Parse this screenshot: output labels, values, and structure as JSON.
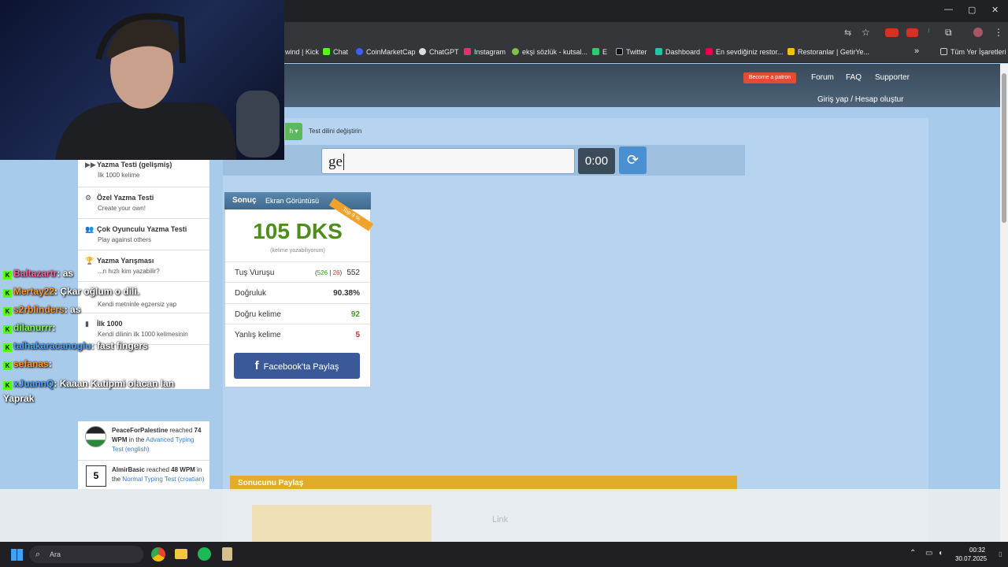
{
  "browser": {
    "bookmarks": [
      "wind | Kick",
      "Chat",
      "CoinMarketCap",
      "ChatGPT",
      "Instagram",
      "ekşi sözlük - kutsal...",
      "E",
      "Twitter",
      "Dashboard",
      "En sevdiğiniz restor...",
      "Restoranlar | GetirYe...",
      "Tüm Yer İşaretleri"
    ],
    "win_controls": [
      "—",
      "▢",
      "✕"
    ]
  },
  "site": {
    "patron": "Become a patron",
    "nav": [
      "Forum",
      "FAQ",
      "Supporter"
    ],
    "login": "Giriş yap / Hesap oluştur",
    "lang_label": "Test dilini değiştirin",
    "lang_btn": "h ▾"
  },
  "typing": {
    "input_value": "ge",
    "timer": "0:00",
    "reload_icon": "refresh-icon"
  },
  "menu": [
    {
      "title": "Yazma Testi (gelişmiş)",
      "sub": "İlk 1000 kelime",
      "icon": "▶▶"
    },
    {
      "title": "Özel Yazma Testi",
      "sub": "Create your own!",
      "icon": "⚙"
    },
    {
      "title": "Çok Oyunculu Yazma Testi",
      "sub": "Play against others",
      "icon": "👥"
    },
    {
      "title": "Yazma Yarışması",
      "sub": "...n hızlı kim yazabilir?",
      "icon": "🏆"
    },
    {
      "title": "",
      "sub": "Kendi metninle egzersiz yap",
      "icon": ""
    },
    {
      "title": "İlk 1000",
      "sub": "Kendi dilinin ilk 1000 kelimesinin",
      "icon": "▮"
    }
  ],
  "result": {
    "title": "Sonuç",
    "screenshot": "Ekran Görüntüsü",
    "ribbon": "Top 9 %",
    "wpm": "105 DKS",
    "wpm_sub": "(kelime yazabiliyorum)",
    "rows": [
      {
        "label": "Tuş Vuruşu",
        "correct": "526",
        "sep": "|",
        "wrong": "26",
        "value": "552"
      },
      {
        "label": "Doğruluk",
        "value": "90.38%"
      },
      {
        "label": "Doğru kelime",
        "value": "92"
      },
      {
        "label": "Yanlış kelime",
        "value": "5"
      }
    ],
    "fb": "Facebook'ta Paylaş"
  },
  "share": {
    "title": "Sonucunu Paylaş",
    "link": "Link"
  },
  "feed": [
    {
      "name": "PeaceForPalestine",
      "mid": " reached ",
      "wpm": "74 WPM",
      "in": " in the ",
      "test": "Advanced Typing Test (english)"
    },
    {
      "name": "AlmirBasic",
      "mid": " reached ",
      "wpm": "48 WPM",
      "in": " in the ",
      "test": "Normal Typing Test (croatian)"
    }
  ],
  "chat": [
    {
      "user": "Baltazartr",
      "msg": ": as",
      "color": "#ff5f9e"
    },
    {
      "user": "Mertay22",
      "msg": ": Çkar oğlum o dili.",
      "color": "#ff9a2e"
    },
    {
      "user": "s2rblinders",
      "msg": ": as",
      "color": "#ff9a2e"
    },
    {
      "user": "dilanurrr",
      "msg": ":",
      "color": "#7cff4a"
    },
    {
      "user": "talhakaracanoglu",
      "msg": ": fast fingers",
      "color": "#4aa3ff"
    },
    {
      "user": "sefanas",
      "msg": ":",
      "color": "#ff9a2e"
    },
    {
      "user": "xJuannQ",
      "msg": ": Kaaan Katipmi olacan lan Yaprak",
      "color": "#4aa3ff"
    }
  ],
  "taskbar": {
    "search": "Ara",
    "time": "00:32",
    "date": "30.07.2025"
  }
}
